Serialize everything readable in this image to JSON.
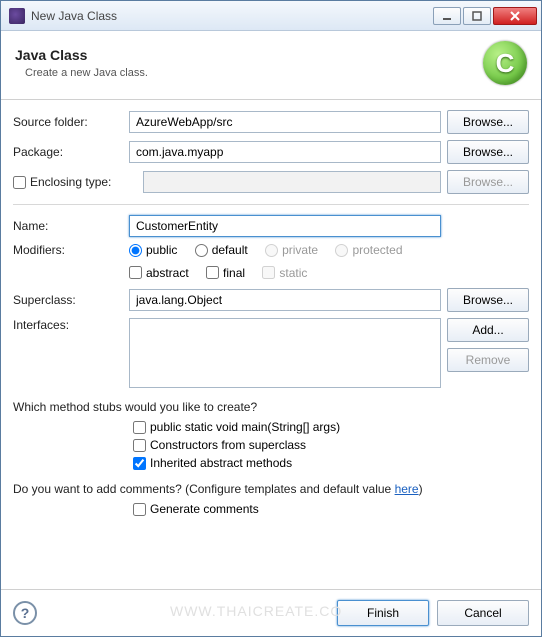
{
  "window": {
    "title": "New Java Class"
  },
  "banner": {
    "heading": "Java Class",
    "sub": "Create a new Java class.",
    "icon_letter": "C"
  },
  "labels": {
    "source_folder": "Source folder:",
    "package": "Package:",
    "enclosing_type": "Enclosing type:",
    "name": "Name:",
    "modifiers": "Modifiers:",
    "superclass": "Superclass:",
    "interfaces": "Interfaces:"
  },
  "values": {
    "source_folder": "AzureWebApp/src",
    "package": "com.java.myapp",
    "enclosing_type": "",
    "name": "CustomerEntity",
    "superclass": "java.lang.Object"
  },
  "modifiers": {
    "public": "public",
    "default": "default",
    "private": "private",
    "protected": "protected",
    "abstract": "abstract",
    "final": "final",
    "static": "static"
  },
  "buttons": {
    "browse": "Browse...",
    "add": "Add...",
    "remove": "Remove",
    "finish": "Finish",
    "cancel": "Cancel"
  },
  "stubs": {
    "question": "Which method stubs would you like to create?",
    "main": "public static void main(String[] args)",
    "constructors": "Constructors from superclass",
    "inherited": "Inherited abstract methods"
  },
  "comments": {
    "question_a": "Do you want to add comments? (Configure templates and default value ",
    "link": "here",
    "question_b": ")",
    "generate": "Generate comments"
  },
  "watermark": "WWW.THAICREATE.CO"
}
